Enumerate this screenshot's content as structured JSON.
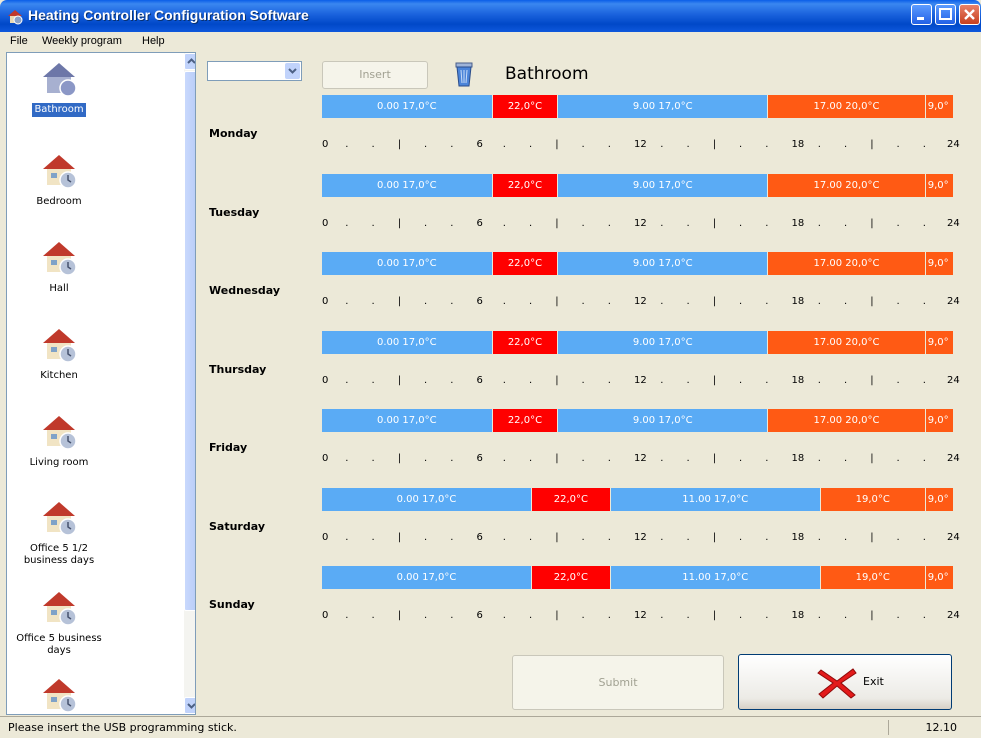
{
  "window": {
    "title": "Heating Controller Configuration Software"
  },
  "menu": [
    "File",
    "Weekly program",
    "Help"
  ],
  "rooms": [
    {
      "label": "Bathroom",
      "selected": true
    },
    {
      "label": "Bedroom"
    },
    {
      "label": "Hall"
    },
    {
      "label": "Kitchen"
    },
    {
      "label": "Living room"
    },
    {
      "label": "Office 5 1/2\nbusiness days"
    },
    {
      "label": "Office 5 business\ndays"
    },
    {
      "label": ""
    }
  ],
  "toolbar": {
    "combo_value": "",
    "insert_label": "Insert",
    "room_title": "Bathroom"
  },
  "colors": {
    "cold": "#5aabf5",
    "red": "#ff0000",
    "orange": "#ff5a14"
  },
  "schedule_scale": [
    "0",
    ".",
    ".",
    "|",
    ".",
    ".",
    "6",
    ".",
    ".",
    "|",
    ".",
    ".",
    "12",
    ".",
    ".",
    "|",
    ".",
    ".",
    "18",
    ".",
    ".",
    "|",
    ".",
    ".",
    "24"
  ],
  "days": [
    {
      "name": "Monday",
      "segments": [
        {
          "label": "0.00 17,0°C",
          "start": 0,
          "end": 6.5,
          "color": "cold"
        },
        {
          "label": "22,0°C",
          "start": 6.5,
          "end": 9,
          "color": "red"
        },
        {
          "label": "9.00 17,0°C",
          "start": 9,
          "end": 17,
          "color": "cold"
        },
        {
          "label": "17.00 20,0°C",
          "start": 17,
          "end": 23,
          "color": "orange"
        },
        {
          "label": "9,0°",
          "start": 23,
          "end": 24,
          "color": "orange"
        }
      ]
    },
    {
      "name": "Tuesday",
      "segments": [
        {
          "label": "0.00 17,0°C",
          "start": 0,
          "end": 6.5,
          "color": "cold"
        },
        {
          "label": "22,0°C",
          "start": 6.5,
          "end": 9,
          "color": "red"
        },
        {
          "label": "9.00 17,0°C",
          "start": 9,
          "end": 17,
          "color": "cold"
        },
        {
          "label": "17.00 20,0°C",
          "start": 17,
          "end": 23,
          "color": "orange"
        },
        {
          "label": "9,0°",
          "start": 23,
          "end": 24,
          "color": "orange"
        }
      ]
    },
    {
      "name": "Wednesday",
      "segments": [
        {
          "label": "0.00 17,0°C",
          "start": 0,
          "end": 6.5,
          "color": "cold"
        },
        {
          "label": "22,0°C",
          "start": 6.5,
          "end": 9,
          "color": "red"
        },
        {
          "label": "9.00 17,0°C",
          "start": 9,
          "end": 17,
          "color": "cold"
        },
        {
          "label": "17.00 20,0°C",
          "start": 17,
          "end": 23,
          "color": "orange"
        },
        {
          "label": "9,0°",
          "start": 23,
          "end": 24,
          "color": "orange"
        }
      ]
    },
    {
      "name": "Thursday",
      "segments": [
        {
          "label": "0.00 17,0°C",
          "start": 0,
          "end": 6.5,
          "color": "cold"
        },
        {
          "label": "22,0°C",
          "start": 6.5,
          "end": 9,
          "color": "red"
        },
        {
          "label": "9.00 17,0°C",
          "start": 9,
          "end": 17,
          "color": "cold"
        },
        {
          "label": "17.00 20,0°C",
          "start": 17,
          "end": 23,
          "color": "orange"
        },
        {
          "label": "9,0°",
          "start": 23,
          "end": 24,
          "color": "orange"
        }
      ]
    },
    {
      "name": "Friday",
      "segments": [
        {
          "label": "0.00 17,0°C",
          "start": 0,
          "end": 6.5,
          "color": "cold"
        },
        {
          "label": "22,0°C",
          "start": 6.5,
          "end": 9,
          "color": "red"
        },
        {
          "label": "9.00 17,0°C",
          "start": 9,
          "end": 17,
          "color": "cold"
        },
        {
          "label": "17.00 20,0°C",
          "start": 17,
          "end": 23,
          "color": "orange"
        },
        {
          "label": "9,0°",
          "start": 23,
          "end": 24,
          "color": "orange"
        }
      ]
    },
    {
      "name": "Saturday",
      "segments": [
        {
          "label": "0.00 17,0°C",
          "start": 0,
          "end": 8,
          "color": "cold"
        },
        {
          "label": "22,0°C",
          "start": 8,
          "end": 11,
          "color": "red"
        },
        {
          "label": "11.00 17,0°C",
          "start": 11,
          "end": 19,
          "color": "cold"
        },
        {
          "label": "19,0°C",
          "start": 19,
          "end": 23,
          "color": "orange"
        },
        {
          "label": "9,0°",
          "start": 23,
          "end": 24,
          "color": "orange"
        }
      ]
    },
    {
      "name": "Sunday",
      "segments": [
        {
          "label": "0.00 17,0°C",
          "start": 0,
          "end": 8,
          "color": "cold"
        },
        {
          "label": "22,0°C",
          "start": 8,
          "end": 11,
          "color": "red"
        },
        {
          "label": "11.00 17,0°C",
          "start": 11,
          "end": 19,
          "color": "cold"
        },
        {
          "label": "19,0°C",
          "start": 19,
          "end": 23,
          "color": "orange"
        },
        {
          "label": "9,0°",
          "start": 23,
          "end": 24,
          "color": "orange"
        }
      ]
    }
  ],
  "buttons": {
    "submit": "Submit",
    "exit": "Exit"
  },
  "status": {
    "message": "Please insert the USB programming stick.",
    "version": "12.10"
  }
}
